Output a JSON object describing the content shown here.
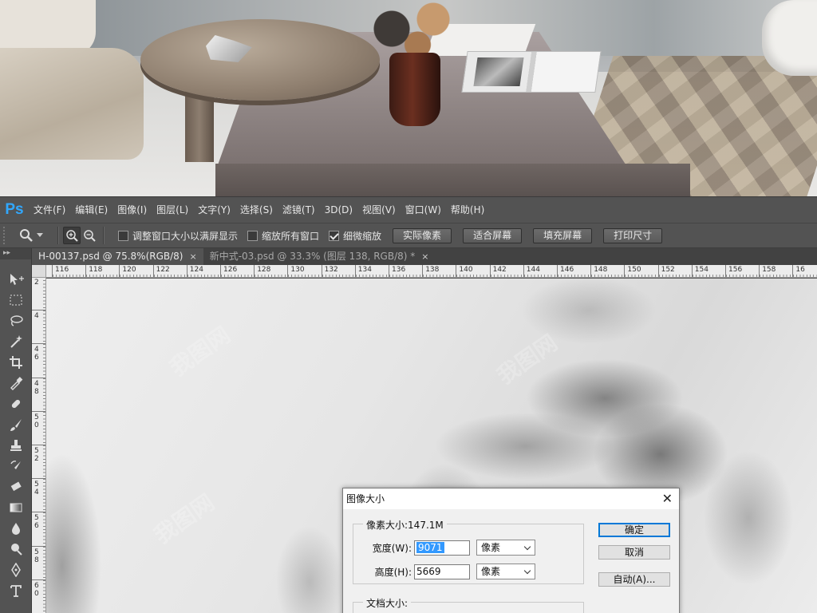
{
  "app": {
    "logo": "Ps"
  },
  "menu": [
    "文件(F)",
    "编辑(E)",
    "图像(I)",
    "图层(L)",
    "文字(Y)",
    "选择(S)",
    "滤镜(T)",
    "3D(D)",
    "视图(V)",
    "窗口(W)",
    "帮助(H)"
  ],
  "options": {
    "checkboxes": [
      {
        "label": "调整窗口大小以满屏显示",
        "checked": false
      },
      {
        "label": "缩放所有窗口",
        "checked": false
      },
      {
        "label": "细微缩放",
        "checked": true
      }
    ],
    "buttons": [
      "实际像素",
      "适合屏幕",
      "填充屏幕",
      "打印尺寸"
    ]
  },
  "toolbox": {
    "header": "▸▸"
  },
  "tabs": [
    {
      "label": "H-00137.psd @ 75.8%(RGB/8)",
      "close": "×",
      "active": true
    },
    {
      "label": "新中式-03.psd @ 33.3% (图层 138, RGB/8) *",
      "close": "×",
      "active": false
    }
  ],
  "ruler_h": [
    "116",
    "118",
    "120",
    "122",
    "124",
    "126",
    "128",
    "130",
    "132",
    "134",
    "136",
    "138",
    "140",
    "142",
    "144",
    "146",
    "148",
    "150",
    "152",
    "154",
    "156",
    "158",
    "16"
  ],
  "ruler_v": [
    "2",
    "4",
    "4 6",
    "4 8",
    "5 0",
    "5 2",
    "5 4",
    "5 6",
    "5 8",
    "6 0"
  ],
  "dialog": {
    "title": "图像大小",
    "close": "✕",
    "pixel_dims_legend": "像素大小:147.1M",
    "width_label": "宽度(W):",
    "width_value": "9071",
    "width_unit": "像素",
    "height_label": "高度(H):",
    "height_value": "5669",
    "height_unit": "像素",
    "doc_size_legend": "文档大小:",
    "ok": "确定",
    "cancel": "取消",
    "auto": "自动(A)..."
  },
  "colors": {
    "ps_blue": "#31a8ff",
    "ui_gray": "#535353",
    "select_blue": "#3399ff"
  }
}
